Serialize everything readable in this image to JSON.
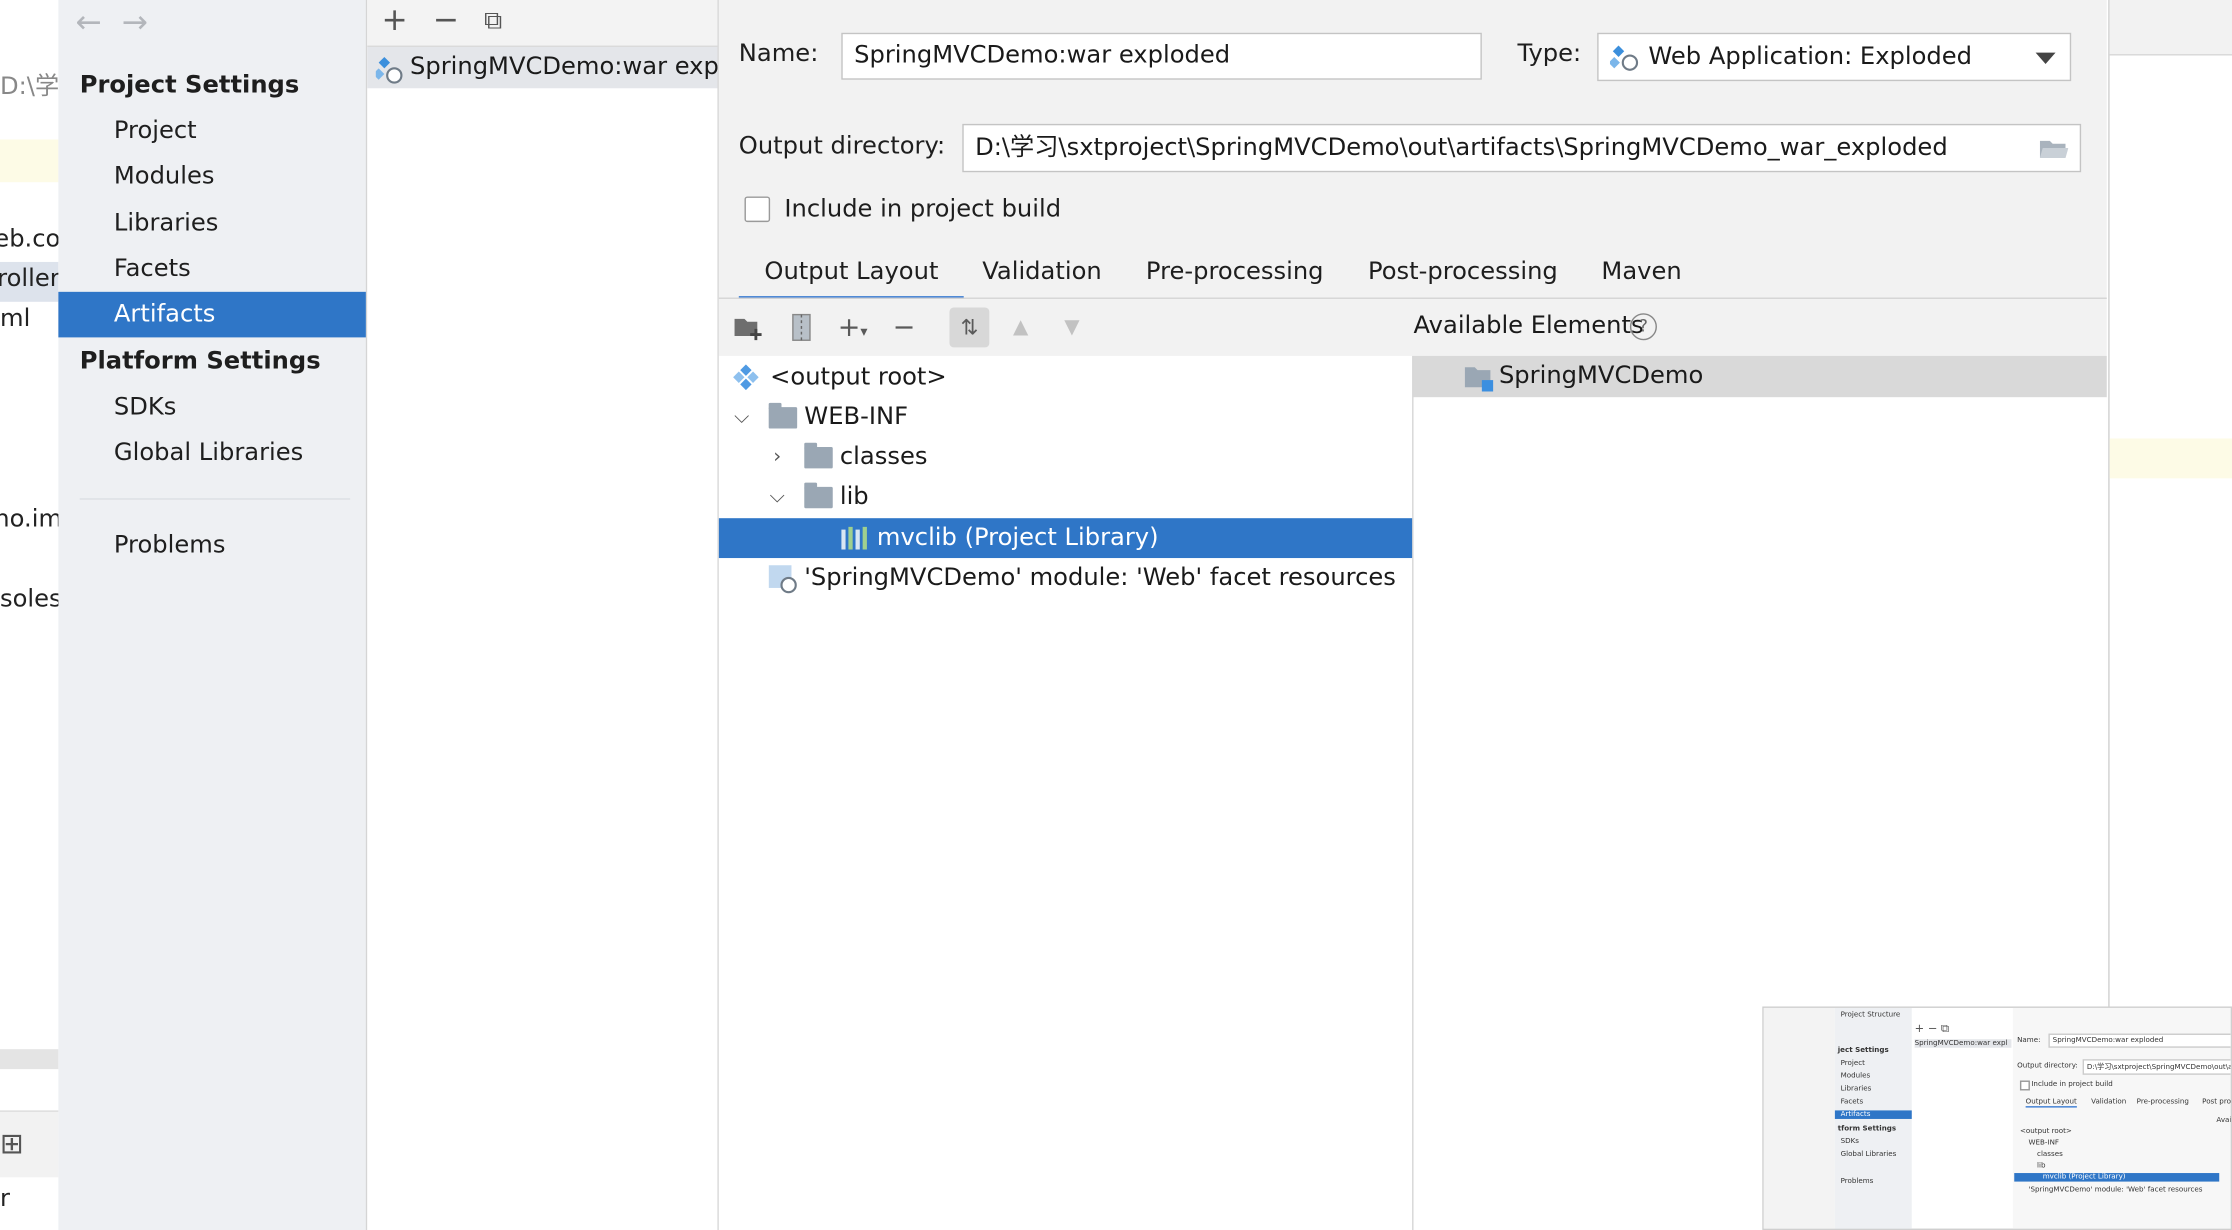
{
  "background_fragments": {
    "path_prefix": "D:\\学",
    "line1": "eb.cor",
    "line2": "roller",
    "line3": "ml",
    "line4": "no.iml",
    "line5": "soles",
    "line6": "r"
  },
  "sidebar": {
    "back_icon": "arrow-left-icon",
    "forward_icon": "arrow-right-icon",
    "project_settings_title": "Project Settings",
    "project_items": [
      {
        "label": "Project"
      },
      {
        "label": "Modules"
      },
      {
        "label": "Libraries"
      },
      {
        "label": "Facets"
      },
      {
        "label": "Artifacts",
        "active": true
      }
    ],
    "platform_settings_title": "Platform Settings",
    "platform_items": [
      {
        "label": "SDKs"
      },
      {
        "label": "Global Libraries"
      }
    ],
    "problems_label": "Problems"
  },
  "artifacts": {
    "add_icon": "plus-icon",
    "remove_icon": "minus-icon",
    "copy_icon": "copy-icon",
    "items": [
      {
        "label": "SpringMVCDemo:war exploded",
        "icon": "web-artifact-icon"
      }
    ]
  },
  "config": {
    "name_label": "Name:",
    "name_value": "SpringMVCDemo:war exploded",
    "type_label": "Type:",
    "type_value": "Web Application: Exploded",
    "output_dir_label": "Output directory:",
    "output_dir_value": "D:\\学习\\sxtproject\\SpringMVCDemo\\out\\artifacts\\SpringMVCDemo_war_exploded",
    "include_in_build_label": "Include in project build",
    "include_in_build_checked": false
  },
  "tabs": [
    {
      "label": "Output Layout",
      "active": true
    },
    {
      "label": "Validation"
    },
    {
      "label": "Pre-processing"
    },
    {
      "label": "Post-processing"
    },
    {
      "label": "Maven"
    }
  ],
  "layout": {
    "toolbar_icons": [
      "new-folder-icon",
      "archive-icon",
      "add-icon",
      "remove-icon",
      "sort-icon",
      "move-up-icon",
      "move-down-icon"
    ],
    "tree": [
      {
        "label": "<output root>",
        "icon": "output-root-icon",
        "depth": 0
      },
      {
        "label": "WEB-INF",
        "icon": "folder-icon",
        "depth": 0,
        "expanded": true
      },
      {
        "label": "classes",
        "icon": "folder-icon",
        "depth": 1,
        "expanded": false
      },
      {
        "label": "lib",
        "icon": "folder-icon",
        "depth": 1,
        "expanded": true
      },
      {
        "label": "mvclib (Project Library)",
        "icon": "library-icon",
        "depth": 2,
        "selected": true
      },
      {
        "label": "'SpringMVCDemo' module: 'Web' facet resources",
        "icon": "web-facet-icon",
        "depth": 0
      }
    ]
  },
  "available": {
    "title": "Available Elements",
    "help_icon": "help-icon",
    "items": [
      {
        "label": "SpringMVCDemo",
        "icon": "module-icon"
      }
    ]
  },
  "thumbnail": {
    "title": "Project Structure",
    "settings_label": "ject Settings",
    "items": [
      "Project",
      "Modules",
      "Libraries",
      "Facets",
      "Artifacts"
    ],
    "platform_label": "tform Settings",
    "platform_items": [
      "SDKs",
      "Global Libraries"
    ],
    "problems": "Problems",
    "artifact": "SpringMVCDemo:war expl",
    "name_label": "Name:",
    "name_value": "SpringMVCDemo:war exploded",
    "output_label": "Output directory:",
    "output_value": "D:\\学习\\sxtproject\\SpringMVCDemo\\out\\ar",
    "include": "Include in project build",
    "tabs": [
      "Output Layout",
      "Validation",
      "Pre-processing",
      "Post pro"
    ],
    "tree": [
      "<output root>",
      "WEB-INF",
      "classes",
      "lib",
      "mvclib (Project Library)",
      "'SpringMVCDemo' module: 'Web' facet resources"
    ],
    "avail": "Avai"
  },
  "colors": {
    "selection": "#2f76c7",
    "sidebar_bg": "#eef0f3",
    "panel_bg": "#f2f2f2",
    "tab_underline": "#3d7dd3"
  }
}
